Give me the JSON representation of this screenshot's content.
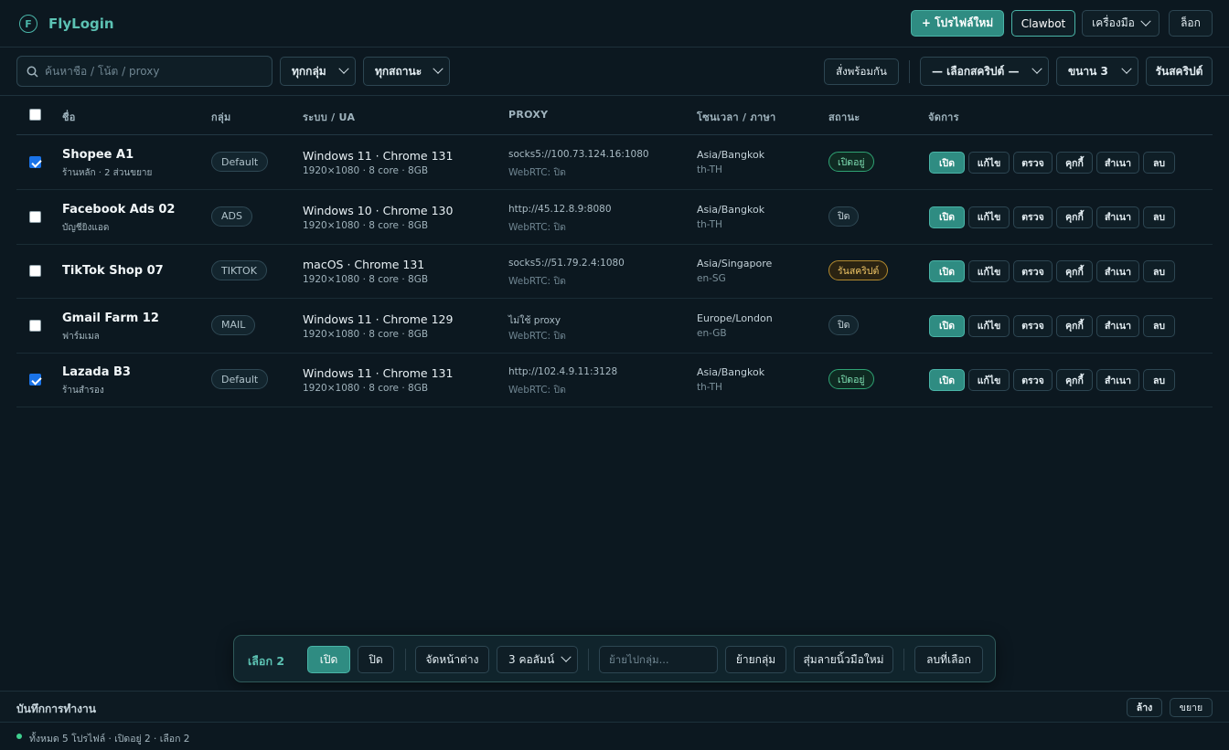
{
  "app": {
    "title": "FlyLogin",
    "logo_letter": "F",
    "new_profile_label": "+ โปรไฟล์ใหม่",
    "clawbot_label": "Clawbot",
    "tools_label": "เครื่องมือ",
    "logout_label": "ล็อก"
  },
  "toolbar": {
    "search_placeholder": "ค้นหาชื่อ / โน้ต / proxy",
    "group_filter": "ทุกกลุ่ม",
    "status_filter": "ทุกสถานะ",
    "sync_label": "สั่งพร้อมกัน",
    "script_select": "— เลือกสคริปต์ —",
    "parallel_select": "ขนาน 3",
    "run_script_label": "รันสคริปต์"
  },
  "table": {
    "headers": {
      "name": "ชื่อ",
      "group": "กลุ่ม",
      "system": "ระบบ / UA",
      "proxy": "PROXY",
      "timezone": "โซนเวลา / ภาษา",
      "status": "สถานะ",
      "actions": "จัดการ"
    },
    "actions": {
      "open": "เปิด",
      "edit": "แก้ไข",
      "check": "ตรวจ",
      "cookie": "คุกกี้",
      "clone": "สำเนา",
      "delete": "ลบ"
    },
    "rows": [
      {
        "checked": true,
        "name": "Shopee A1",
        "note": "ร้านหลัก · 2 ส่วนขยาย",
        "group": "Default",
        "os": "Windows 11 · Chrome 131",
        "hw": "1920×1080 · 8 core · 8GB",
        "proxy": "socks5://100.73.124.16:1080",
        "webrtc": "WebRTC: ปิด",
        "tz": "Asia/Bangkok",
        "lang": "th-TH",
        "status": "เปิดอยู่",
        "status_kind": "on"
      },
      {
        "checked": false,
        "name": "Facebook Ads 02",
        "note": "บัญชียิงแอด",
        "group": "ADS",
        "os": "Windows 10 · Chrome 130",
        "hw": "1920×1080 · 8 core · 8GB",
        "proxy": "http://45.12.8.9:8080",
        "webrtc": "WebRTC: ปิด",
        "tz": "Asia/Bangkok",
        "lang": "th-TH",
        "status": "ปิด",
        "status_kind": "off"
      },
      {
        "checked": false,
        "name": "TikTok Shop 07",
        "note": "",
        "group": "TIKTOK",
        "os": "macOS · Chrome 131",
        "hw": "1920×1080 · 8 core · 8GB",
        "proxy": "socks5://51.79.2.4:1080",
        "webrtc": "WebRTC: ปิด",
        "tz": "Asia/Singapore",
        "lang": "en-SG",
        "status": "รันสคริปต์",
        "status_kind": "run"
      },
      {
        "checked": false,
        "name": "Gmail Farm 12",
        "note": "ฟาร์มเมล",
        "group": "MAIL",
        "os": "Windows 11 · Chrome 129",
        "hw": "1920×1080 · 8 core · 8GB",
        "proxy": "ไม่ใช้ proxy",
        "webrtc": "WebRTC: ปิด",
        "tz": "Europe/London",
        "lang": "en-GB",
        "status": "ปิด",
        "status_kind": "off"
      },
      {
        "checked": true,
        "name": "Lazada B3",
        "note": "ร้านสำรอง",
        "group": "Default",
        "os": "Windows 11 · Chrome 131",
        "hw": "1920×1080 · 8 core · 8GB",
        "proxy": "http://102.4.9.11:3128",
        "webrtc": "WebRTC: ปิด",
        "tz": "Asia/Bangkok",
        "lang": "th-TH",
        "status": "เปิดอยู่",
        "status_kind": "on"
      }
    ]
  },
  "bulk": {
    "selected_label": "เลือก 2",
    "open_label": "เปิด",
    "close_label": "ปิด",
    "arrange_label": "จัดหน้าต่าง",
    "columns_select": "3 คอลัมน์",
    "move_placeholder": "ย้ายไปกลุ่ม...",
    "move_label": "ย้ายกลุ่ม",
    "randomize_label": "สุ่มลายนิ้วมือใหม่",
    "delete_label": "ลบที่เลือก"
  },
  "log": {
    "title": "บันทึกการทำงาน",
    "clear_label": "ล้าง",
    "expand_label": "ขยาย"
  },
  "statusbar": {
    "text": "ทั้งหมด 5 โปรไฟล์ · เปิดอยู่ 2 · เลือก 2"
  },
  "colors": {
    "accent": "#4ab5a8",
    "background": "#0c1820",
    "status_on": "#7fe0b3",
    "status_run": "#f2c766"
  }
}
